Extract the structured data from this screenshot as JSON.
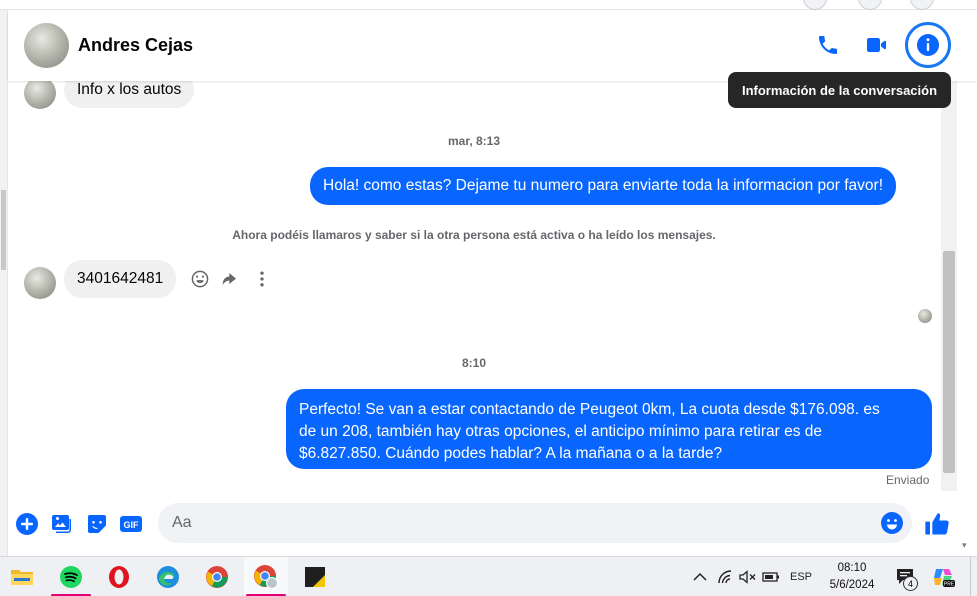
{
  "header": {
    "contact_name": "Andres Cejas"
  },
  "tooltip": {
    "text": "Información de la conversación"
  },
  "messages": [
    {
      "direction": "in",
      "text": "Info x los autos"
    },
    {
      "type": "time",
      "text": "mar, 8:13"
    },
    {
      "direction": "out",
      "text": "Hola! como estas? Dejame tu numero para enviarte toda la informacion por favor!"
    },
    {
      "type": "notice",
      "text": "Ahora podéis llamaros y saber si la otra persona está activa o ha leído los mensajes."
    },
    {
      "direction": "in",
      "text": "3401642481"
    },
    {
      "type": "time",
      "text": "8:10"
    },
    {
      "direction": "out",
      "lines": [
        "Perfecto!  Se van a estar contactando de Peugeot 0km, La cuota desde $176.098. es",
        "de un 208, también hay otras opciones, el anticipo mínimo para retirar es de",
        "$6.827.850. Cuándo podes hablar? A la mañana o a la tarde?"
      ]
    }
  ],
  "status": {
    "sent": "Enviado"
  },
  "composer": {
    "placeholder": "Aa",
    "gif_label": "GIF"
  },
  "taskbar": {
    "apps": [
      "file-explorer",
      "spotify",
      "opera",
      "edge",
      "chrome",
      "chrome-profile",
      "sticky-app"
    ],
    "language": "ESP",
    "time": "08:10",
    "date": "5/6/2024",
    "notification_count": "4",
    "copilot_badge": "PRE"
  },
  "colors": {
    "accent": "#0866ff",
    "incoming_bubble": "#f0f0f0",
    "tooltip_bg": "#262626"
  }
}
